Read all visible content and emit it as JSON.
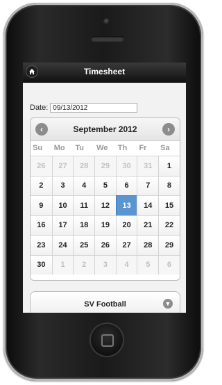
{
  "header": {
    "title": "Timesheet",
    "home_icon": "home-icon"
  },
  "form": {
    "date_label": "Date:",
    "date_value": "09/13/2012"
  },
  "calendar": {
    "month_label": "September 2012",
    "prev_icon": "chevron-left-icon",
    "next_icon": "chevron-right-icon",
    "weekdays": [
      "Su",
      "Mo",
      "Tu",
      "We",
      "Th",
      "Fr",
      "Sa"
    ],
    "weeks": [
      [
        {
          "d": "26",
          "o": true
        },
        {
          "d": "27",
          "o": true
        },
        {
          "d": "28",
          "o": true
        },
        {
          "d": "29",
          "o": true
        },
        {
          "d": "30",
          "o": true
        },
        {
          "d": "31",
          "o": true
        },
        {
          "d": "1"
        }
      ],
      [
        {
          "d": "2"
        },
        {
          "d": "3"
        },
        {
          "d": "4"
        },
        {
          "d": "5"
        },
        {
          "d": "6"
        },
        {
          "d": "7"
        },
        {
          "d": "8"
        }
      ],
      [
        {
          "d": "9"
        },
        {
          "d": "10"
        },
        {
          "d": "11"
        },
        {
          "d": "12"
        },
        {
          "d": "13",
          "s": true
        },
        {
          "d": "14"
        },
        {
          "d": "15"
        }
      ],
      [
        {
          "d": "16"
        },
        {
          "d": "17"
        },
        {
          "d": "18"
        },
        {
          "d": "19"
        },
        {
          "d": "20"
        },
        {
          "d": "21"
        },
        {
          "d": "22"
        }
      ],
      [
        {
          "d": "23"
        },
        {
          "d": "24"
        },
        {
          "d": "25"
        },
        {
          "d": "26"
        },
        {
          "d": "27"
        },
        {
          "d": "28"
        },
        {
          "d": "29"
        }
      ],
      [
        {
          "d": "30"
        },
        {
          "d": "1",
          "o": true
        },
        {
          "d": "2",
          "o": true
        },
        {
          "d": "3",
          "o": true
        },
        {
          "d": "4",
          "o": true
        },
        {
          "d": "5",
          "o": true
        },
        {
          "d": "6",
          "o": true
        }
      ]
    ],
    "selected_color": "#5a95cf"
  },
  "project_select": {
    "value": "SV Football",
    "arrow_icon": "chevron-down-icon"
  }
}
